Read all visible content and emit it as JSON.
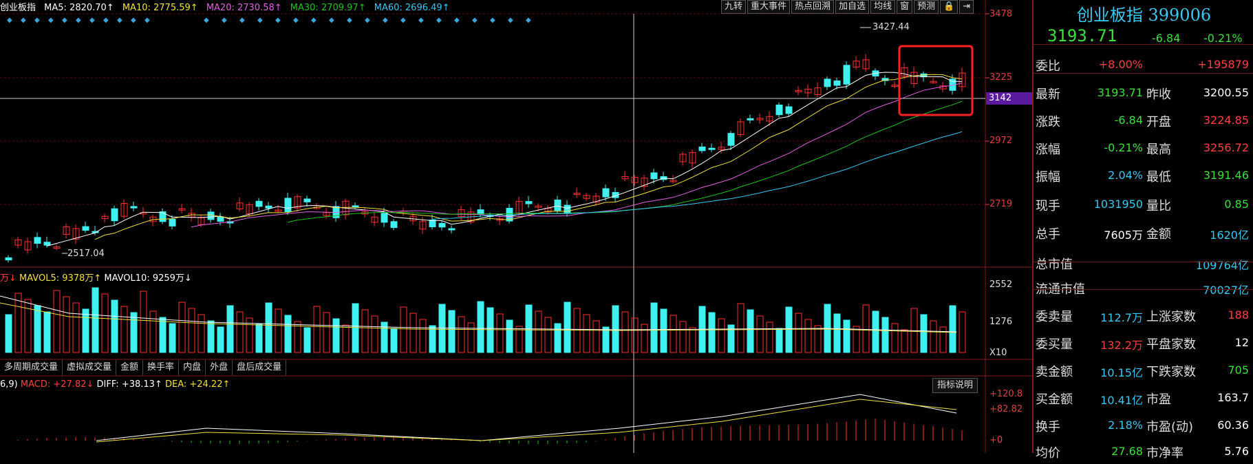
{
  "header": {
    "name": "创业板指",
    "ma5": "MA5: 2820.70↑",
    "ma10": "MA10: 2775.59↑",
    "ma20": "MA20: 2730.58↑",
    "ma30": "MA30: 2709.97↑",
    "ma60": "MA60: 2696.49↑"
  },
  "toolbar": [
    "九转",
    "重大事件",
    "热点回溯",
    "加自选",
    "均线",
    "窗",
    "预测"
  ],
  "price_axis": [
    "3478",
    "3225",
    "2972",
    "2719"
  ],
  "crosshair_price": "3142",
  "annotations": {
    "high": "3427.44",
    "low": "2517.04"
  },
  "volume_header": {
    "mavol5": "MAVOL5: 9378万↑",
    "mavol10": "MAVOL10: 9259万↓"
  },
  "volume_axis": [
    "2552",
    "1276",
    "X10"
  ],
  "tabs": [
    "多周期成交量",
    "虚拟成交量",
    "金额",
    "换手率",
    "内盘",
    "外盘",
    "盘后成交量"
  ],
  "macd_header": {
    "params": "6,9)",
    "macd": "MACD: +27.82↓",
    "diff": "DIFF: +38.13↑",
    "dea": "DEA: +24.22↑"
  },
  "macd_axis": [
    "+120.8",
    "+82.82",
    "+0"
  ],
  "macd_button": "指标说明",
  "colors": {
    "up": "#ff3030",
    "down": "#40f0f0",
    "ma5": "#ffffff",
    "ma10": "#f0e040",
    "ma20": "#e060e0",
    "ma30": "#20c020",
    "ma60": "#39c8f0"
  },
  "panel": {
    "title": "创业板指 399006",
    "price": "3193.71",
    "change": "-6.84",
    "pct": "-0.21%",
    "rows": [
      {
        "l": "委比",
        "v": "+8.00%",
        "l2": "",
        "v2": "+195879"
      },
      {
        "l": "最新",
        "v": "3193.71",
        "l2": "昨收",
        "v2": "3200.55"
      },
      {
        "l": "涨跌",
        "v": "-6.84",
        "l2": "开盘",
        "v2": "3224.85"
      },
      {
        "l": "涨幅",
        "v": "-0.21%",
        "l2": "最高",
        "v2": "3256.72"
      },
      {
        "l": "振幅",
        "v": "2.04%",
        "l2": "最低",
        "v2": "3191.46"
      },
      {
        "l": "现手",
        "v": "1031950",
        "l2": "量比",
        "v2": "0.85"
      },
      {
        "l": "总手",
        "v": "7605万",
        "l2": "金额",
        "v2": "1620亿"
      },
      {
        "l": "总市值",
        "v": "",
        "l2": "",
        "v2": "109764亿"
      },
      {
        "l": "流通市值",
        "v": "",
        "l2": "",
        "v2": "70027亿"
      },
      {
        "l": "委卖量",
        "v": "112.7万",
        "l2": "上涨家数",
        "v2": "188"
      },
      {
        "l": "委买量",
        "v": "132.2万",
        "l2": "平盘家数",
        "v2": "12"
      },
      {
        "l": "卖金额",
        "v": "10.15亿",
        "l2": "下跌家数",
        "v2": "705"
      },
      {
        "l": "买金额",
        "v": "10.41亿",
        "l2": "市盈",
        "v2": "163.7"
      },
      {
        "l": "换手",
        "v": "2.18%",
        "l2": "市盈(动)",
        "v2": "60.36"
      },
      {
        "l": "均价",
        "v": "27.68",
        "l2": "市净率",
        "v2": "5.76"
      }
    ]
  }
}
